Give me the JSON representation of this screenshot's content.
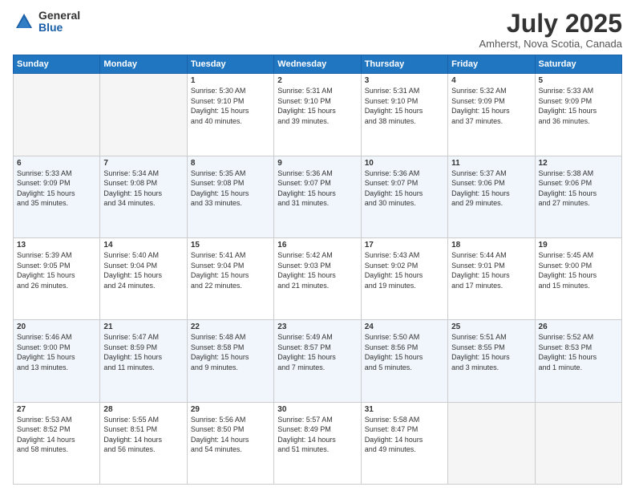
{
  "logo": {
    "general": "General",
    "blue": "Blue"
  },
  "header": {
    "month": "July 2025",
    "location": "Amherst, Nova Scotia, Canada"
  },
  "weekdays": [
    "Sunday",
    "Monday",
    "Tuesday",
    "Wednesday",
    "Thursday",
    "Friday",
    "Saturday"
  ],
  "weeks": [
    [
      {
        "day": "",
        "info": ""
      },
      {
        "day": "",
        "info": ""
      },
      {
        "day": "1",
        "info": "Sunrise: 5:30 AM\nSunset: 9:10 PM\nDaylight: 15 hours\nand 40 minutes."
      },
      {
        "day": "2",
        "info": "Sunrise: 5:31 AM\nSunset: 9:10 PM\nDaylight: 15 hours\nand 39 minutes."
      },
      {
        "day": "3",
        "info": "Sunrise: 5:31 AM\nSunset: 9:10 PM\nDaylight: 15 hours\nand 38 minutes."
      },
      {
        "day": "4",
        "info": "Sunrise: 5:32 AM\nSunset: 9:09 PM\nDaylight: 15 hours\nand 37 minutes."
      },
      {
        "day": "5",
        "info": "Sunrise: 5:33 AM\nSunset: 9:09 PM\nDaylight: 15 hours\nand 36 minutes."
      }
    ],
    [
      {
        "day": "6",
        "info": "Sunrise: 5:33 AM\nSunset: 9:09 PM\nDaylight: 15 hours\nand 35 minutes."
      },
      {
        "day": "7",
        "info": "Sunrise: 5:34 AM\nSunset: 9:08 PM\nDaylight: 15 hours\nand 34 minutes."
      },
      {
        "day": "8",
        "info": "Sunrise: 5:35 AM\nSunset: 9:08 PM\nDaylight: 15 hours\nand 33 minutes."
      },
      {
        "day": "9",
        "info": "Sunrise: 5:36 AM\nSunset: 9:07 PM\nDaylight: 15 hours\nand 31 minutes."
      },
      {
        "day": "10",
        "info": "Sunrise: 5:36 AM\nSunset: 9:07 PM\nDaylight: 15 hours\nand 30 minutes."
      },
      {
        "day": "11",
        "info": "Sunrise: 5:37 AM\nSunset: 9:06 PM\nDaylight: 15 hours\nand 29 minutes."
      },
      {
        "day": "12",
        "info": "Sunrise: 5:38 AM\nSunset: 9:06 PM\nDaylight: 15 hours\nand 27 minutes."
      }
    ],
    [
      {
        "day": "13",
        "info": "Sunrise: 5:39 AM\nSunset: 9:05 PM\nDaylight: 15 hours\nand 26 minutes."
      },
      {
        "day": "14",
        "info": "Sunrise: 5:40 AM\nSunset: 9:04 PM\nDaylight: 15 hours\nand 24 minutes."
      },
      {
        "day": "15",
        "info": "Sunrise: 5:41 AM\nSunset: 9:04 PM\nDaylight: 15 hours\nand 22 minutes."
      },
      {
        "day": "16",
        "info": "Sunrise: 5:42 AM\nSunset: 9:03 PM\nDaylight: 15 hours\nand 21 minutes."
      },
      {
        "day": "17",
        "info": "Sunrise: 5:43 AM\nSunset: 9:02 PM\nDaylight: 15 hours\nand 19 minutes."
      },
      {
        "day": "18",
        "info": "Sunrise: 5:44 AM\nSunset: 9:01 PM\nDaylight: 15 hours\nand 17 minutes."
      },
      {
        "day": "19",
        "info": "Sunrise: 5:45 AM\nSunset: 9:00 PM\nDaylight: 15 hours\nand 15 minutes."
      }
    ],
    [
      {
        "day": "20",
        "info": "Sunrise: 5:46 AM\nSunset: 9:00 PM\nDaylight: 15 hours\nand 13 minutes."
      },
      {
        "day": "21",
        "info": "Sunrise: 5:47 AM\nSunset: 8:59 PM\nDaylight: 15 hours\nand 11 minutes."
      },
      {
        "day": "22",
        "info": "Sunrise: 5:48 AM\nSunset: 8:58 PM\nDaylight: 15 hours\nand 9 minutes."
      },
      {
        "day": "23",
        "info": "Sunrise: 5:49 AM\nSunset: 8:57 PM\nDaylight: 15 hours\nand 7 minutes."
      },
      {
        "day": "24",
        "info": "Sunrise: 5:50 AM\nSunset: 8:56 PM\nDaylight: 15 hours\nand 5 minutes."
      },
      {
        "day": "25",
        "info": "Sunrise: 5:51 AM\nSunset: 8:55 PM\nDaylight: 15 hours\nand 3 minutes."
      },
      {
        "day": "26",
        "info": "Sunrise: 5:52 AM\nSunset: 8:53 PM\nDaylight: 15 hours\nand 1 minute."
      }
    ],
    [
      {
        "day": "27",
        "info": "Sunrise: 5:53 AM\nSunset: 8:52 PM\nDaylight: 14 hours\nand 58 minutes."
      },
      {
        "day": "28",
        "info": "Sunrise: 5:55 AM\nSunset: 8:51 PM\nDaylight: 14 hours\nand 56 minutes."
      },
      {
        "day": "29",
        "info": "Sunrise: 5:56 AM\nSunset: 8:50 PM\nDaylight: 14 hours\nand 54 minutes."
      },
      {
        "day": "30",
        "info": "Sunrise: 5:57 AM\nSunset: 8:49 PM\nDaylight: 14 hours\nand 51 minutes."
      },
      {
        "day": "31",
        "info": "Sunrise: 5:58 AM\nSunset: 8:47 PM\nDaylight: 14 hours\nand 49 minutes."
      },
      {
        "day": "",
        "info": ""
      },
      {
        "day": "",
        "info": ""
      }
    ]
  ]
}
